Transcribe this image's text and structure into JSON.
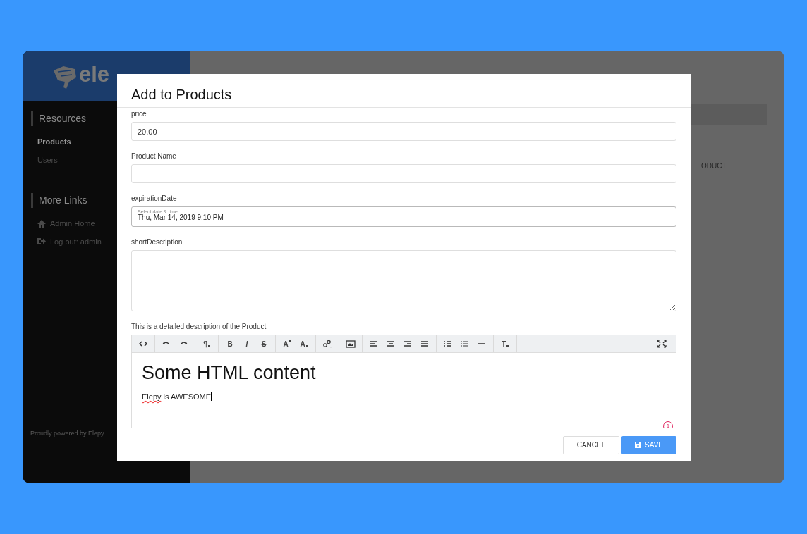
{
  "sidebar": {
    "logo": {
      "text": "ele"
    },
    "sections": [
      {
        "title": "Resources",
        "items": [
          {
            "label": "Products",
            "selected": true
          },
          {
            "label": "Users",
            "selected": false
          }
        ]
      },
      {
        "title": "More Links",
        "items": [
          {
            "label": "Admin Home",
            "selected": false
          },
          {
            "label": "Log out: admin",
            "selected": false
          }
        ]
      }
    ],
    "footer": {
      "text": "Proudly powered by",
      "link": "Elepy"
    }
  },
  "main": {
    "column_header": "ODUCT"
  },
  "modal": {
    "title": "Add to Products",
    "fields": [
      {
        "kind": "input",
        "label": "price",
        "value": "20.00"
      },
      {
        "kind": "input",
        "label": "Product Name"
      },
      {
        "kind": "date",
        "label": "expirationDate",
        "placeholder": "Select date & time",
        "value": "Thu, Mar 14, 2019 9:10 PM"
      },
      {
        "kind": "textarea",
        "label": "shortDescription"
      },
      {
        "kind": "editor",
        "label": "This is a detailed description of the Product"
      }
    ],
    "editor": {
      "toolbar": [
        [
          {
            "kind": "code"
          }
        ],
        [
          {
            "kind": "undo"
          },
          {
            "kind": "redo"
          }
        ],
        [
          {
            "kind": "paragraph",
            "label": "¶"
          }
        ],
        [
          {
            "kind": "bold",
            "label": "B"
          },
          {
            "kind": "italic",
            "label": "I"
          },
          {
            "kind": "strike",
            "label": "S"
          }
        ],
        [
          {
            "kind": "superscript",
            "label": "A"
          },
          {
            "kind": "subscript",
            "label": "A"
          }
        ],
        [
          {
            "kind": "link"
          }
        ],
        [
          {
            "kind": "image"
          }
        ],
        [
          {
            "kind": "align-left"
          },
          {
            "kind": "align-center"
          },
          {
            "kind": "align-right"
          },
          {
            "kind": "justify"
          }
        ],
        [
          {
            "kind": "bullet-list"
          },
          {
            "kind": "numbered-list"
          },
          {
            "kind": "rule"
          }
        ],
        [
          {
            "kind": "clear-format",
            "label": "T"
          }
        ]
      ],
      "fullscreen": true,
      "heading": "Some HTML content",
      "paragraph": [
        {
          "text": "Elepy",
          "misspelled": true
        },
        {
          "text": " is AWESOME",
          "misspelled": false
        }
      ],
      "badge": "1"
    },
    "buttons": [
      {
        "kind": "cancel",
        "label": "CANCEL"
      },
      {
        "kind": "save",
        "label": "SAVE"
      }
    ]
  }
}
